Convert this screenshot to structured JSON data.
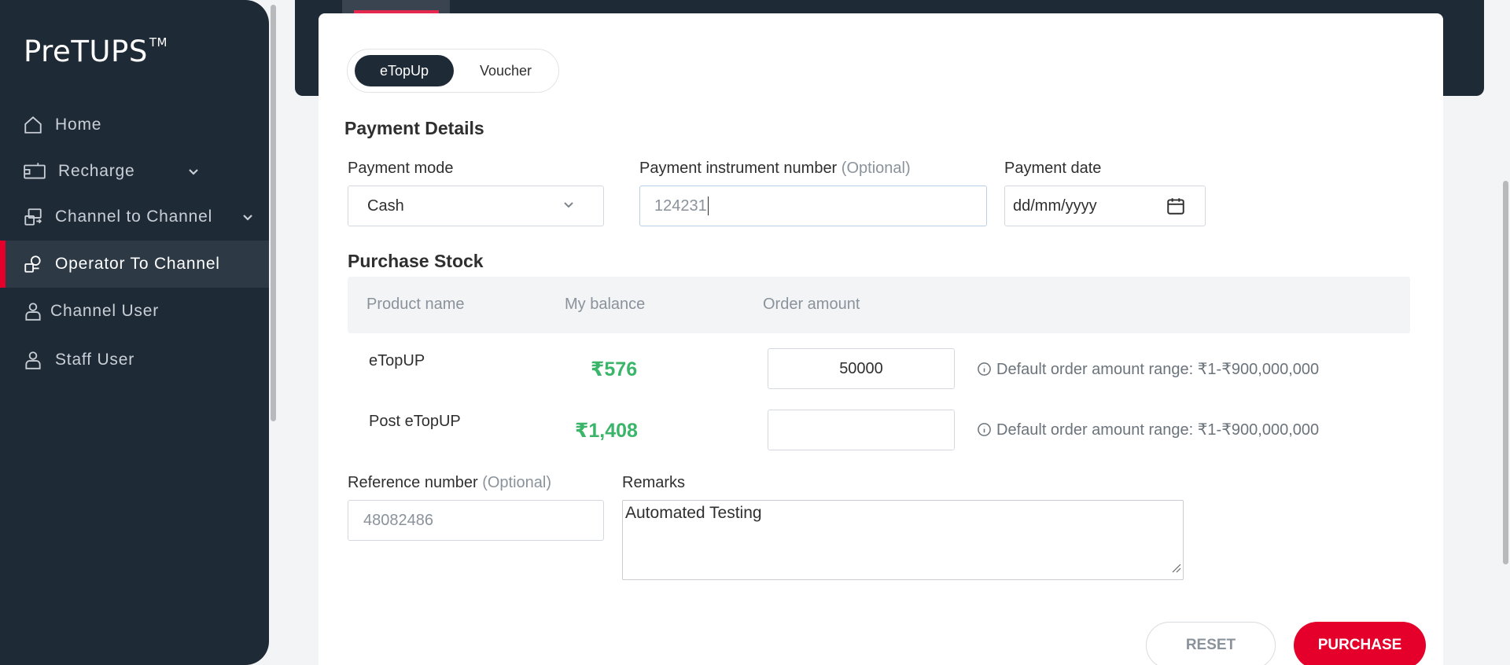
{
  "app": {
    "logo_text": "PreTUPS",
    "logo_tm": "TM"
  },
  "sidebar": {
    "items": [
      {
        "label": "Home",
        "icon": "home-icon"
      },
      {
        "label": "Recharge",
        "icon": "recharge-icon",
        "expandable": true
      },
      {
        "label": "Channel to Channel",
        "icon": "channel-transfer-icon",
        "expandable": true
      },
      {
        "label": "Operator To Channel",
        "icon": "operator-channel-icon",
        "active": true
      },
      {
        "label": "Channel User",
        "icon": "user-icon"
      },
      {
        "label": "Staff User",
        "icon": "user-icon"
      }
    ]
  },
  "toggle": {
    "options": [
      "eTopUp",
      "Voucher"
    ],
    "selected": "eTopUp"
  },
  "payment": {
    "title": "Payment Details",
    "mode_label": "Payment mode",
    "mode_value": "Cash",
    "instrument_label": "Payment instrument number",
    "instrument_optional": "(Optional)",
    "instrument_value": "124231",
    "date_label": "Payment date",
    "date_placeholder": "dd/mm/yyyy"
  },
  "stock": {
    "title": "Purchase Stock",
    "columns": [
      "Product name",
      "My balance",
      "Order amount"
    ],
    "rows": [
      {
        "product": "eTopUP",
        "balance": "₹576",
        "amount": "50000",
        "hint": "Default order amount range: ₹1-₹900,000,000"
      },
      {
        "product": "Post eTopUP",
        "balance": "₹1,408",
        "amount": "",
        "hint": "Default order amount range: ₹1-₹900,000,000"
      }
    ]
  },
  "reference": {
    "label": "Reference number",
    "optional": "(Optional)",
    "value": "48082486"
  },
  "remarks": {
    "label": "Remarks",
    "value": "Automated Testing"
  },
  "actions": {
    "reset_label": "RESET",
    "purchase_label": "PURCHASE"
  },
  "colors": {
    "sidebar_bg": "#1f2a37",
    "accent": "#e4002b",
    "balance_green": "#3bb56a"
  }
}
